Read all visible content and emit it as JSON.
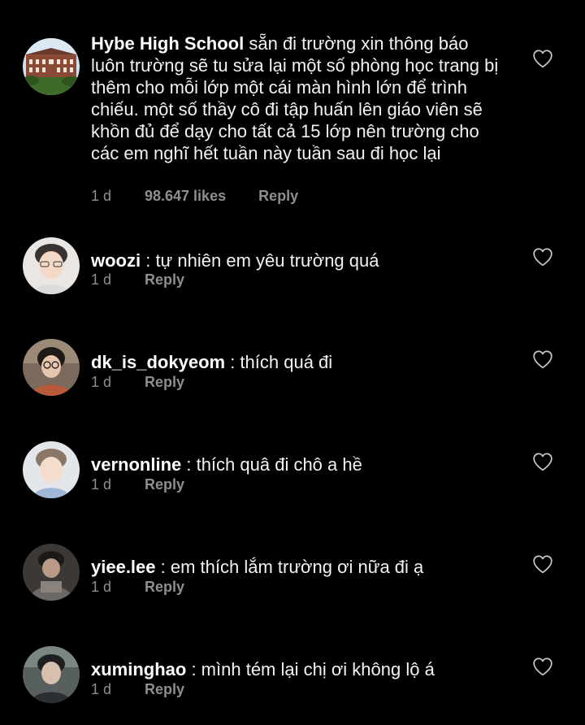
{
  "comments": [
    {
      "username": "Hybe High School",
      "text": " sẵn đi trường xin thông báo luôn trường sẽ tu sửa lại một số phòng học trang bị thêm cho mỗi lớp một cái màn hình lớn để trình chiếu. một số thầy cô đi tập huấn lên giáo viên sẽ khồn đủ để dạy cho tất cả 15 lớp nên trường cho các em nghĩ hết tuần này tuần sau đi học lại",
      "time": "1 d",
      "likes": "98.647 likes",
      "reply": "Reply",
      "avatar": "building-photo"
    },
    {
      "username": "woozi",
      "text": " : tự nhiên em yêu trường quá",
      "time": "1 d",
      "reply": "Reply",
      "avatar": "person-photo"
    },
    {
      "username": "dk_is_dokyeom",
      "text": " : thích quá đi",
      "time": "1 d",
      "reply": "Reply",
      "avatar": "person-photo"
    },
    {
      "username": "vernonline",
      "text": " : thích quâ đi chô a hề",
      "time": "1 d",
      "reply": "Reply",
      "avatar": "person-photo"
    },
    {
      "username": "yiee.lee",
      "text": " : em thích lắm trường ơi nữa đi ạ",
      "time": "1 d",
      "reply": "Reply",
      "avatar": "person-photo"
    },
    {
      "username": "xuminghao",
      "text": " : mình tém lại chị ơi không lộ á",
      "time": "1 d",
      "reply": "Reply",
      "avatar": "person-photo"
    }
  ],
  "icons": {
    "like": "heart-outline-icon"
  },
  "colors": {
    "background": "#000000",
    "text": "#f2f2f2",
    "meta": "#8e8e8e"
  }
}
